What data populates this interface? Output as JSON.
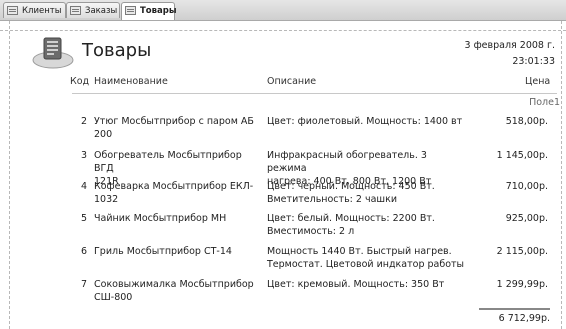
{
  "tabs": [
    {
      "label": "Клиенты"
    },
    {
      "label": "Заказы"
    },
    {
      "label": "Товары"
    }
  ],
  "report": {
    "title": "Товары",
    "date": "3 февраля 2008 г.",
    "time": "23:01:33",
    "headers": {
      "code": "Код",
      "name": "Наименование",
      "description": "Описание",
      "price": "Цена"
    },
    "pole_label": "Поле1",
    "rows": [
      {
        "code": "2",
        "name_1": "Утюг Мосбытприбор с паром АБ",
        "name_2": "200",
        "desc_1": "Цвет: фиолетовый. Мощность: 1400 вт",
        "desc_2": "",
        "price": "518,00р."
      },
      {
        "code": "3",
        "name_1": "Обогреватель Мосбытприбор ВГД",
        "name_2": "121R",
        "desc_1": "Инфракрасный обогреватель. 3 режима",
        "desc_2": "нагрева: 400 Вт, 800 Вт, 1200 Вт",
        "price": "1 145,00р."
      },
      {
        "code": "4",
        "name_1": "Кофеварка Мосбытприбор ЕКЛ-",
        "name_2": "1032",
        "desc_1": "Цвет: черный. Мощность: 450 Вт.",
        "desc_2": "Вметительность: 2 чашки",
        "price": "710,00р."
      },
      {
        "code": "5",
        "name_1": "Чайник Мосбытприбор МН",
        "name_2": "",
        "desc_1": "Цвет: белый. Мощность: 2200 Вт.",
        "desc_2": "Вместимость: 2 л",
        "price": "925,00р."
      },
      {
        "code": "6",
        "name_1": "Гриль Мосбытприбор СТ-14",
        "name_2": "",
        "desc_1": "Мощность 1440 Вт.  Быстрый нагрев.",
        "desc_2": "Термостат. Цветовой индкатор работы",
        "price": "2 115,00р."
      },
      {
        "code": "7",
        "name_1": "Соковыжималка Мосбытприбор",
        "name_2": "СШ-800",
        "desc_1": "Цвет: кремовый. Мощность: 350 Вт",
        "desc_2": "",
        "price": "1 299,99р."
      }
    ],
    "total": "6 712,99р."
  }
}
